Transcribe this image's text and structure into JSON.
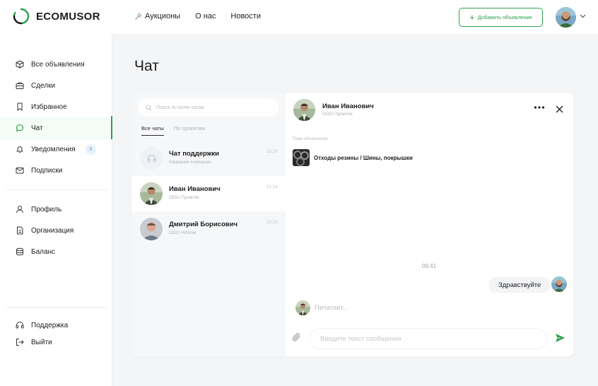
{
  "header": {
    "brand": "ECOMUSOR",
    "nav": [
      {
        "label": "Аукционы",
        "icon": "auction-icon"
      },
      {
        "label": "О нас"
      },
      {
        "label": "Новости"
      }
    ],
    "add_button": "Добавить объявление",
    "user_avatar": "avatar",
    "menu_chevron": "chevron-down-icon"
  },
  "sidebar": {
    "group1": [
      {
        "label": "Все объявления",
        "icon": "box-icon"
      },
      {
        "label": "Сделки",
        "icon": "briefcase-icon"
      },
      {
        "label": "Избранное",
        "icon": "bookmark-icon"
      },
      {
        "label": "Чат",
        "icon": "chat-icon",
        "active": true
      },
      {
        "label": "Уведомления",
        "icon": "bell-icon",
        "badge": "3"
      },
      {
        "label": "Подписки",
        "icon": "mail-icon"
      }
    ],
    "group2": [
      {
        "label": "Профиль",
        "icon": "user-icon"
      },
      {
        "label": "Организация",
        "icon": "document-icon"
      },
      {
        "label": "Баланс",
        "icon": "coins-icon"
      }
    ],
    "group3": [
      {
        "label": "Поддержка",
        "icon": "headset-icon"
      },
      {
        "label": "Выйти",
        "icon": "logout-icon"
      }
    ]
  },
  "page": {
    "title": "Чат"
  },
  "chat_list": {
    "search_placeholder": "Поиск по всем чатам",
    "tabs": [
      {
        "label": "Все чаты",
        "active": true
      },
      {
        "label": "По проектам"
      }
    ],
    "conversations": [
      {
        "name": "Чат поддержки",
        "subtitle": "Название компании",
        "time": "15:20"
      },
      {
        "name": "Иван Иванович",
        "subtitle": "ООО Промтек",
        "time": "12:14",
        "active": true
      },
      {
        "name": "Дмитрий Борисович",
        "subtitle": "ООО НИКом",
        "time": "15:20"
      }
    ]
  },
  "conversation": {
    "name": "Иван Иванович",
    "company": "ООО Промтек",
    "topic_label": "Тема объявления",
    "topic": "Отходы резины / Шины, покрышки",
    "date": "09:41",
    "message": "Здравствуйте",
    "typing": "Печатает...",
    "input_placeholder": "Введите текст сообщения"
  },
  "colors": {
    "accent": "#2ba24c",
    "active_bg": "#f5fbf7",
    "badge_bg": "#e8f2fb"
  }
}
